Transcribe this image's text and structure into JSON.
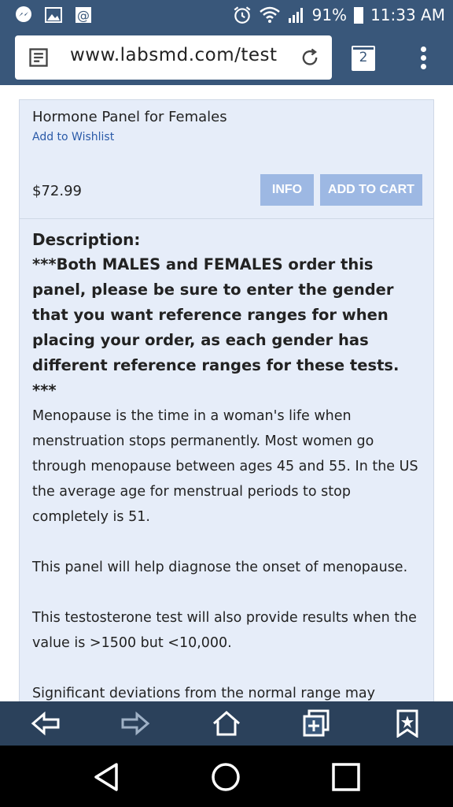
{
  "status_bar": {
    "battery": "91%",
    "time": "11:33 AM"
  },
  "browser": {
    "url": "www.labsmd.com/test",
    "tab_count": "2"
  },
  "product": {
    "title": "Hormone Panel for Females",
    "wishlist_label": "Add to Wishlist",
    "price": "$72.99",
    "info_label": "INFO",
    "cart_label": "ADD TO CART"
  },
  "description": {
    "heading": "Description:",
    "notice": "***Both MALES and FEMALES order this panel, please be sure to enter the gender that you want reference ranges for when placing your order, as each gender has different reference ranges for these tests. ***",
    "paragraphs": [
      "Menopause is the time in a woman's life when menstruation stops permanently. Most women go through menopause between ages 45 and 55. In the US the average age for menstrual periods to stop completely is 51.",
      "This panel will help diagnose the onset of menopause.",
      "This testosterone test will also provide results when the value is >1500 but <10,000.",
      "Significant deviations from the normal range may require further evaluation by your physician."
    ]
  },
  "web_toolbar": [
    "back-icon",
    "forward-icon",
    "home-icon",
    "new-tab-icon",
    "bookmark-icon"
  ],
  "nav_bar": [
    "back-triangle-icon",
    "home-circle-icon",
    "recents-square-icon"
  ]
}
